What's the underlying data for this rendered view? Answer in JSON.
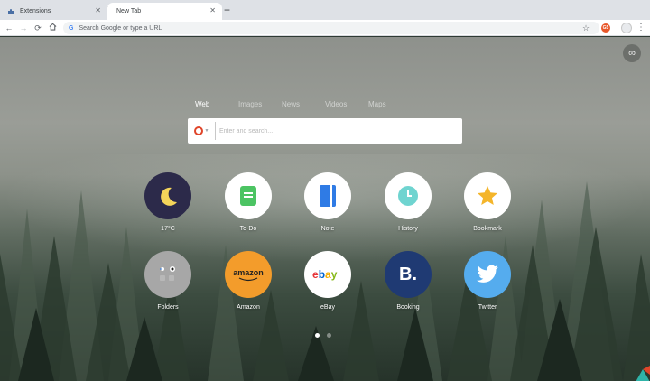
{
  "tabs": [
    {
      "title": "Extensions",
      "active": false
    },
    {
      "title": "New Tab",
      "active": true
    }
  ],
  "toolbar": {
    "omnibox_placeholder": "Search Google or type a URL",
    "google_mark": "G",
    "ext_badge": "G5"
  },
  "search": {
    "tabs": [
      "Web",
      "Images",
      "News",
      "Videos",
      "Maps"
    ],
    "selected_tab": "Web",
    "placeholder": "Enter and search..."
  },
  "tiles": [
    {
      "label": "17°C",
      "icon": "moon-icon",
      "bg": "#2c2a4a"
    },
    {
      "label": "To-Do",
      "icon": "todo-icon",
      "bg": "#ffffff"
    },
    {
      "label": "Note",
      "icon": "note-icon",
      "bg": "#ffffff"
    },
    {
      "label": "History",
      "icon": "clock-icon",
      "bg": "#ffffff"
    },
    {
      "label": "Bookmark",
      "icon": "star-icon",
      "bg": "#ffffff"
    },
    {
      "label": "Folders",
      "icon": "folder-icon",
      "bg": "#a7a7a7"
    },
    {
      "label": "Amazon",
      "icon": "amazon-icon",
      "bg": "#f39c2b",
      "logo_text": "amazon"
    },
    {
      "label": "eBay",
      "icon": "ebay-icon",
      "bg": "#ffffff"
    },
    {
      "label": "Booking",
      "icon": "booking-icon",
      "bg": "#1f3a73",
      "logo_text": "B."
    },
    {
      "label": "Twitter",
      "icon": "twitter-icon",
      "bg": "#55acee"
    }
  ],
  "pager": {
    "pages": 2,
    "current": 1
  },
  "colors": {
    "accent_search": "#e0452a",
    "todo_green": "#4cc463",
    "note_blue": "#2f7be5",
    "history_teal": "#6fd4d0",
    "bookmark_yellow": "#f4b52a"
  }
}
